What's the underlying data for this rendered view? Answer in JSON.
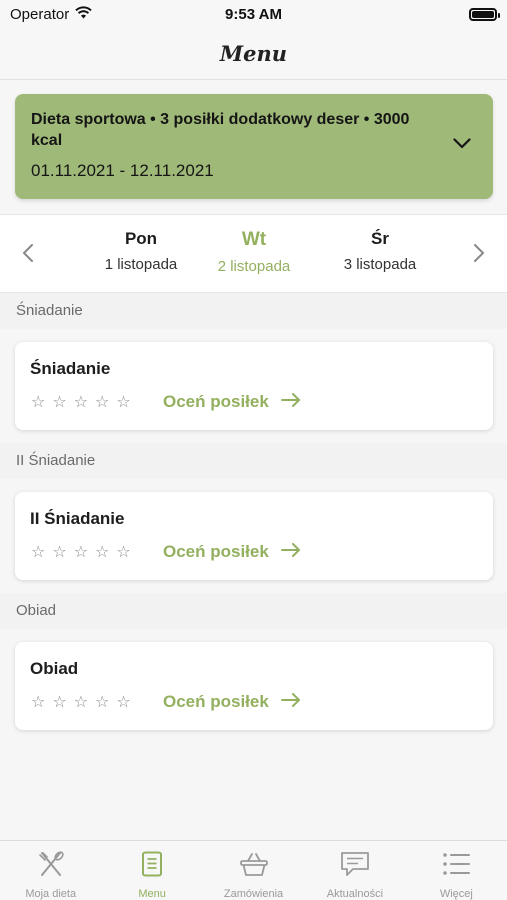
{
  "status": {
    "carrier": "Operator",
    "time": "9:53 AM"
  },
  "nav": {
    "title": "Menu"
  },
  "diet": {
    "name": "Dieta sportowa • 3 posiłki dodatkowy deser • 3000 kcal",
    "dates": "01.11.2021 - 12.11.2021"
  },
  "days": [
    {
      "name": "Pon",
      "date": "1 listopada"
    },
    {
      "name": "Wt",
      "date": "2 listopada"
    },
    {
      "name": "Śr",
      "date": "3 listopada"
    }
  ],
  "active_day": "Wt",
  "sections": [
    {
      "label": "Śniadanie",
      "meal": "Śniadanie",
      "rating": 0
    },
    {
      "label": "II Śniadanie",
      "meal": "II Śniadanie",
      "rating": 0
    },
    {
      "label": "Obiad",
      "meal": "Obiad",
      "rating": 0
    }
  ],
  "rate_label": "Oceń posiłek",
  "tabs": [
    {
      "label": "Moja dieta",
      "icon": "fork-knife-icon"
    },
    {
      "label": "Menu",
      "icon": "menu-document-icon"
    },
    {
      "label": "Zamówienia",
      "icon": "basket-icon"
    },
    {
      "label": "Aktualności",
      "icon": "chat-news-icon"
    },
    {
      "label": "Więcej",
      "icon": "list-more-icon"
    }
  ],
  "active_tab": "Menu",
  "colors": {
    "accent": "#93b05f",
    "diet_card": "#9fb978",
    "inactive": "#9a9a9a"
  }
}
